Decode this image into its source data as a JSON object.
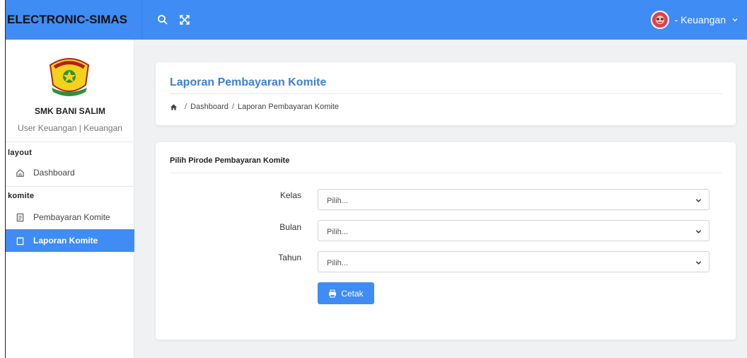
{
  "app": {
    "brand": "ELECTRONIC-SIMAS",
    "user_label": "- Keuangan"
  },
  "sidebar": {
    "school_name": "SMK BANI SALIM",
    "user_role": "User Keuangan | Keuangan",
    "sections": [
      {
        "label": "layout",
        "items": [
          {
            "label": "Dashboard",
            "icon": "home-icon"
          }
        ]
      },
      {
        "label": "komite",
        "items": [
          {
            "label": "Pembayaran Komite",
            "icon": "document-icon"
          },
          {
            "label": "Laporan Komite",
            "icon": "clipboard-icon",
            "active": true
          }
        ]
      }
    ]
  },
  "header_card": {
    "title": "Laporan Pembayaran Komite",
    "breadcrumb": [
      "Dashboard",
      "Laporan Pembayaran Komite"
    ],
    "breadcrumb_separator": "/"
  },
  "form_card": {
    "title": "Pilih Pirode Pembayaran Komite",
    "fields": [
      {
        "label": "Kelas",
        "value": "Pilih..."
      },
      {
        "label": "Bulan",
        "value": "Pilih..."
      },
      {
        "label": "Tahun",
        "value": "Pilih..."
      }
    ],
    "submit_label": "Cetak"
  },
  "colors": {
    "accent": "#3f8cf4",
    "title": "#3f7ed8",
    "avatar": "#e53d54"
  }
}
